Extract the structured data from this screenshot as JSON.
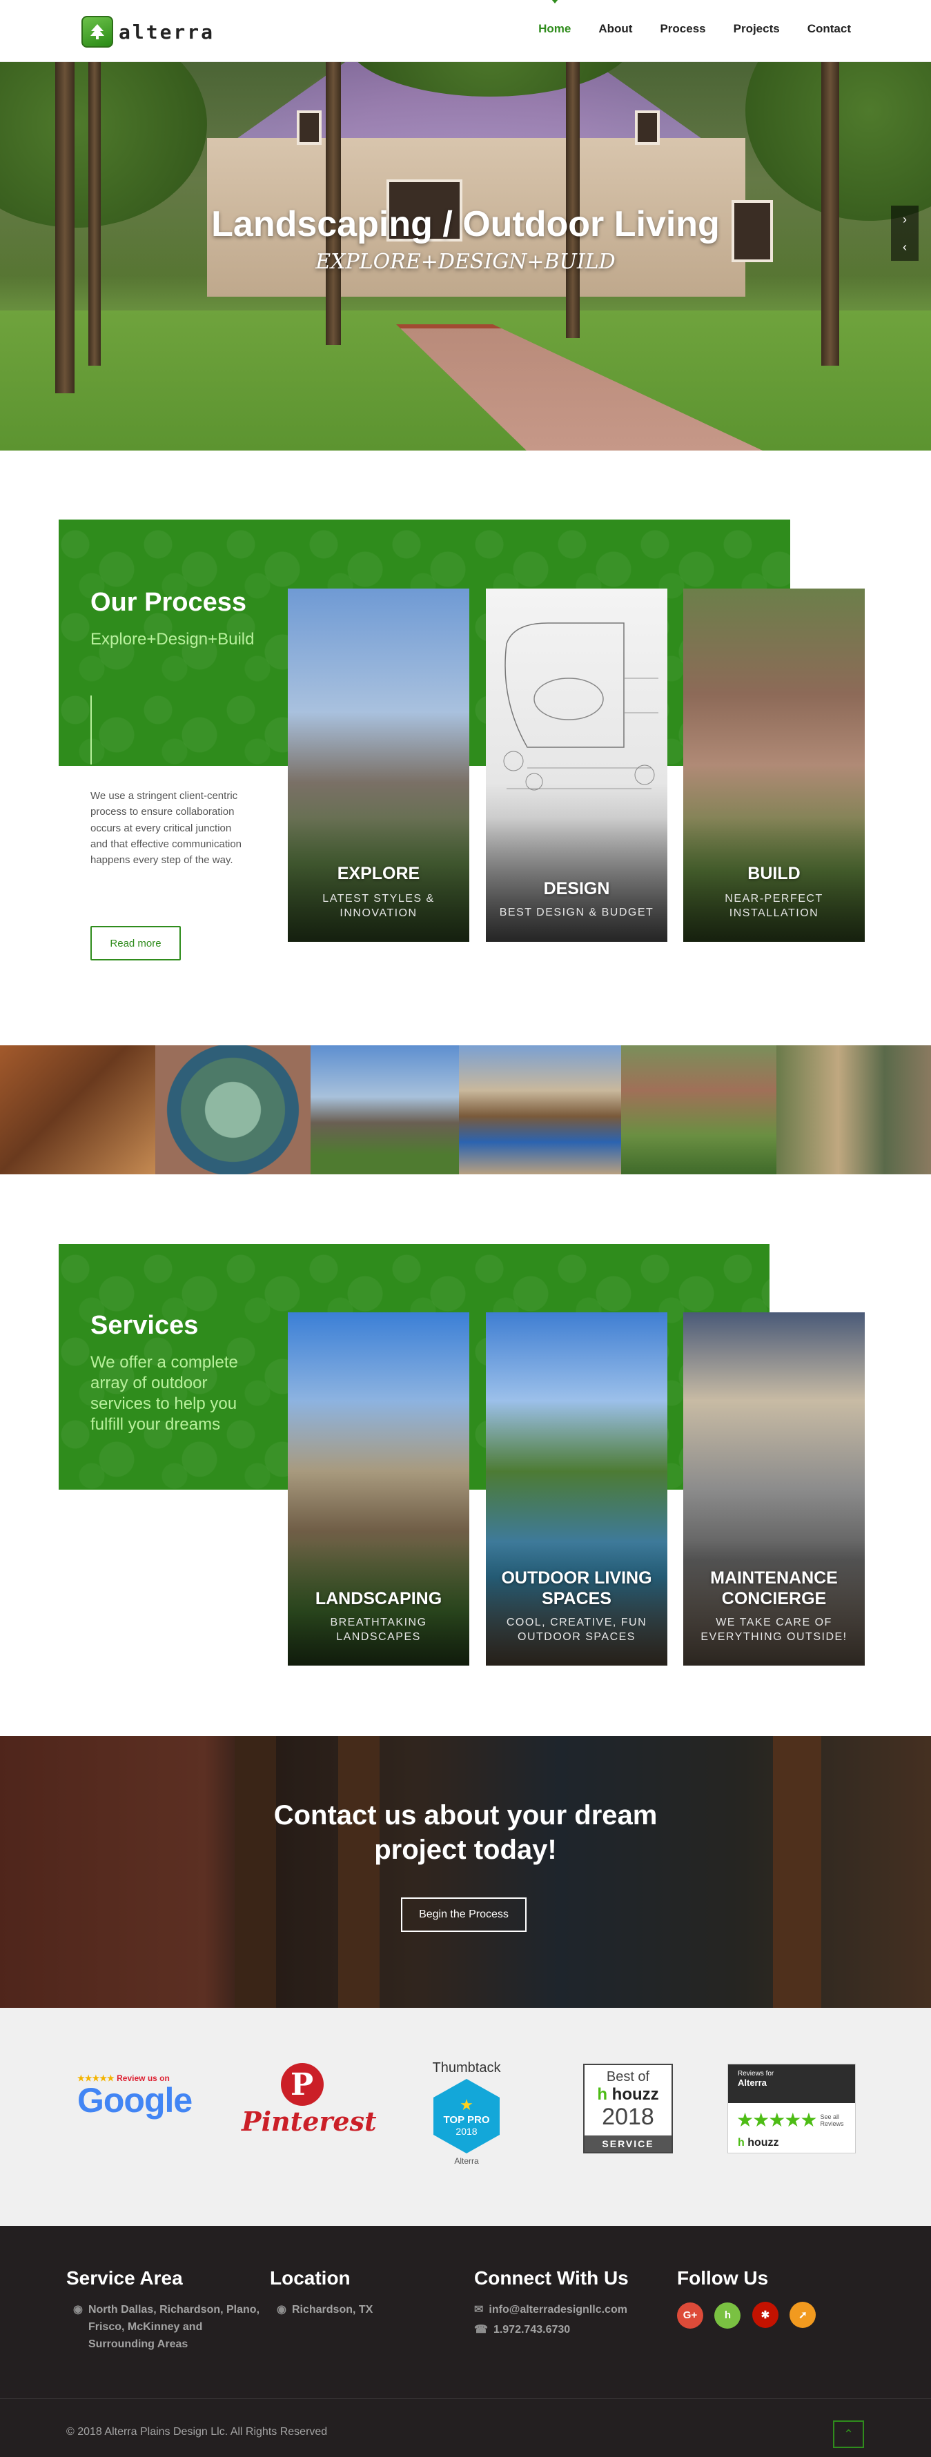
{
  "header": {
    "logo_text": "alterra",
    "nav": [
      {
        "label": "Home"
      },
      {
        "label": "About"
      },
      {
        "label": "Process"
      },
      {
        "label": "Projects"
      },
      {
        "label": "Contact"
      }
    ]
  },
  "hero": {
    "title": "Landscaping / Outdoor Living",
    "subtitle": "EXPLORE+DESIGN+BUILD"
  },
  "process": {
    "title": "Our Process",
    "subtitle": "Explore+Design+Build",
    "description": "We use a stringent client-centric process to ensure collaboration occurs at every critical junction and that effective communication happens every step of the way.",
    "button": "Read more",
    "cards": [
      {
        "title": "EXPLORE",
        "subtitle": "LATEST STYLES & INNOVATION"
      },
      {
        "title": "DESIGN",
        "subtitle": "BEST DESIGN & BUDGET"
      },
      {
        "title": "BUILD",
        "subtitle": "NEAR-PERFECT INSTALLATION"
      }
    ]
  },
  "services": {
    "title": "Services",
    "subtitle": "We offer a complete array of outdoor services to help you fulfill your dreams",
    "cards": [
      {
        "title": "LANDSCAPING",
        "subtitle": "BREATHTAKING LANDSCAPES"
      },
      {
        "title": "OUTDOOR LIVING SPACES",
        "subtitle": "COOL, CREATIVE, FUN OUTDOOR SPACES"
      },
      {
        "title": "MAINTENANCE CONCIERGE",
        "subtitle": "WE TAKE CARE OF EVERYTHING OUTSIDE!"
      }
    ]
  },
  "banner": {
    "title": "Contact us about your dream project today!",
    "button": "Begin the Process"
  },
  "badges": {
    "google_top": "Review us on",
    "google_word": "Google",
    "pinterest": "Pinterest",
    "thumbtack": "Thumbtack",
    "thumbtack_line1": "TOP PRO",
    "thumbtack_line2": "2018",
    "thumbtack_caption": "Alterra",
    "houzz_best": "Best of",
    "houzz_word": "houzz",
    "houzz_year": "2018",
    "houzz_service": "SERVICE",
    "reviews_for": "Reviews for",
    "reviews_name": "Alterra",
    "reviews_see": "See all Reviews",
    "reviews_houzz": "houzz"
  },
  "footer": {
    "service_title": "Service Area",
    "service_text": "North Dallas, Richardson, Plano, Frisco, McKinney and Surrounding Areas",
    "location_title": "Location",
    "location_text": "Richardson, TX",
    "connect_title": "Connect With Us",
    "email": "info@alterradesignllc.com",
    "phone": "1.972.743.6730",
    "follow_title": "Follow Us",
    "copyright": "© 2018 Alterra Plains Design Llc. All Rights Reserved"
  },
  "colors": {
    "brand_green": "#2f8c1c",
    "accent_light_green": "#b8f09c",
    "footer_bg": "#231f20",
    "badge_bg": "#f0f0f0"
  },
  "icons": {
    "prev": "chevron-left-icon",
    "next": "chevron-right-icon",
    "to_top": "chevron-up-icon",
    "social": [
      "google-plus-icon",
      "houzz-icon",
      "yelp-icon",
      "thumbtack-icon"
    ]
  }
}
